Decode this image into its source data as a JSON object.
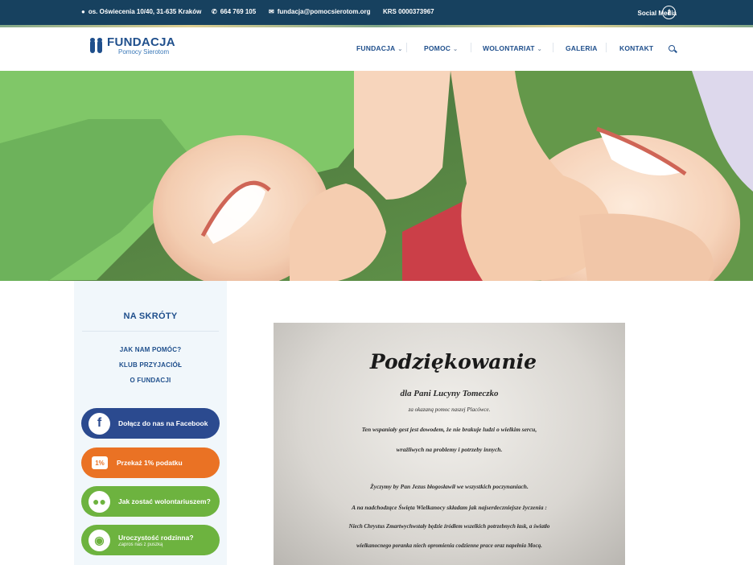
{
  "topbar": {
    "address": "os. Oświecenia 10/40, 31-635 Kraków",
    "phone": "664 769 105",
    "email": "fundacja@pomocsierotom.org",
    "krs": "KRS 0000373967",
    "social_label": "Social Media",
    "social_icon": "facebook-icon"
  },
  "header": {
    "logo_main": "FUNDACJA",
    "logo_sub": "Pomocy Sierotom",
    "nav": [
      {
        "label": "FUNDACJA",
        "has_dropdown": true
      },
      {
        "label": "POMOC",
        "has_dropdown": true
      },
      {
        "label": "WOLONTARIAT",
        "has_dropdown": true
      },
      {
        "label": "GALERIA",
        "has_dropdown": false
      },
      {
        "label": "KONTAKT",
        "has_dropdown": false
      }
    ],
    "search_icon": "search-icon"
  },
  "sidebar": {
    "title": "NA SKRÓTY",
    "links": [
      "JAK NAM POMÓC?",
      "KLUB PRZYJACIÓŁ",
      "O FUNDACJI"
    ],
    "ctas": [
      {
        "label": "Dołącz do nas na Facebook",
        "icon": "facebook-icon",
        "color": "#2b4a8f"
      },
      {
        "label": "Przekaż 1% podatku",
        "icon": "tax-percent-icon",
        "color": "#ea7224"
      },
      {
        "label": "Jak zostać wolontariuszem?",
        "icon": "people-icon",
        "color": "#6db33f"
      },
      {
        "label": "Uroczystość rodzinna?",
        "sub": "Zaproś nas z puszką",
        "icon": "piggy-bank-icon",
        "color": "#6db33f"
      }
    ]
  },
  "letter": {
    "title": "Podziękowanie",
    "lines": [
      "dla Pani Lucyny Tomeczko",
      "za okazaną pomoc naszej Placówce.",
      "Ten wspaniały gest jest dowodem, że nie brakuje ludzi o wielkim sercu,",
      "wrażliwych na problemy i potrzeby innych.",
      "Życzymy by Pan Jezus błogosławił we wszystkich poczynaniach.",
      "A na nadchodzące Święta Wielkanocy składam jak najserdeczniejsze życzenia :",
      "Niech Chrystus Zmartwychwstały będzie źródłem wszelkich potrzebnych łask, a światło",
      "wielkanocnego poranka niech opromienia codzienne prace oraz napełnia Mocą."
    ]
  },
  "colors": {
    "topbar": "#17415f",
    "brand_blue": "#1f4f8c",
    "facebook": "#2b4a8f",
    "orange": "#ea7224",
    "green": "#6db33f",
    "sidebar_bg": "#f1f7fb"
  }
}
